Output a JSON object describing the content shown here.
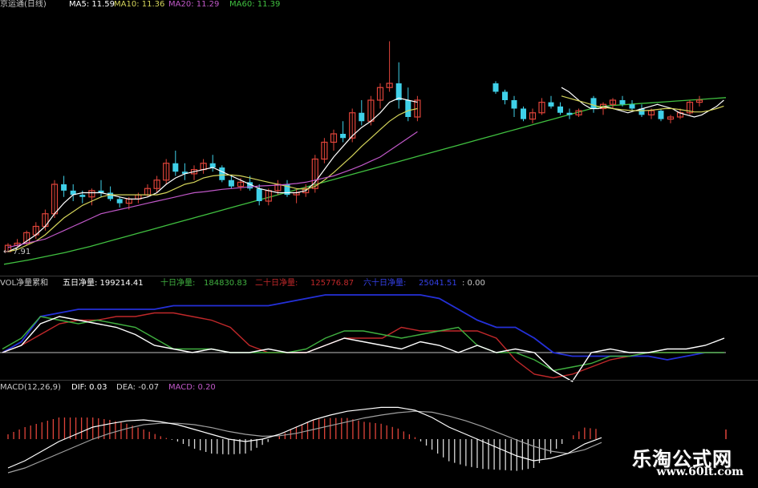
{
  "price_header": {
    "title": "京运通(日线)",
    "ma5": "MA5: 11.59",
    "ma10": "MA10: 11.36",
    "ma20": "MA20: 11.29",
    "ma60": "MA60: 11.39",
    "low_label": "7.91",
    "low_arrow": "←"
  },
  "vol_header": {
    "title": "VOL净量累和",
    "five_day": "五日净量: 199214.41",
    "ten_day_label": "十日净量:",
    "ten_day_value": "184830.83",
    "twenty_day_label": "二十日净量:",
    "twenty_day_value": "125776.87",
    "sixty_day_label": "六十日净量:",
    "sixty_day_value": "25041.51",
    "tail": ": 0.00"
  },
  "macd_header": {
    "title": "MACD(12,26,9)",
    "dif": "DIF: 0.03",
    "dea": "DEA: -0.07",
    "macd": "MACD: 0.20"
  },
  "watermark": {
    "line1": "乐淘公式网",
    "line2": "www.60lt.com"
  },
  "colors": {
    "up": "#e0443a",
    "down": "#3fd0e8",
    "ma5": "#ffffff",
    "ma10": "#d4d45a",
    "ma20": "#c058c8",
    "ma60": "#40c040",
    "vol_white": "#ffffff",
    "vol_green": "#40b040",
    "vol_red": "#c0282a",
    "vol_blue": "#2430d8",
    "zero_line": "#c0c0c0"
  },
  "chart_data": [
    {
      "type": "candlestick",
      "title": "京运通(日线)",
      "ylim": [
        7.5,
        13.5
      ],
      "candles": [
        [
          7.9,
          8.1,
          7.9,
          8.05
        ],
        [
          8.05,
          8.2,
          8.0,
          8.1
        ],
        [
          8.1,
          8.4,
          8.05,
          8.35
        ],
        [
          8.3,
          8.6,
          8.2,
          8.5
        ],
        [
          8.5,
          8.9,
          8.4,
          8.8
        ],
        [
          8.8,
          9.6,
          8.7,
          9.5
        ],
        [
          9.5,
          9.7,
          9.2,
          9.35
        ],
        [
          9.35,
          9.5,
          9.1,
          9.25
        ],
        [
          9.25,
          9.35,
          9.05,
          9.2
        ],
        [
          9.2,
          9.4,
          9.0,
          9.35
        ],
        [
          9.35,
          9.6,
          9.2,
          9.3
        ],
        [
          9.3,
          9.45,
          9.1,
          9.15
        ],
        [
          9.15,
          9.2,
          8.95,
          9.05
        ],
        [
          9.05,
          9.2,
          8.9,
          9.15
        ],
        [
          9.15,
          9.3,
          9.05,
          9.25
        ],
        [
          9.25,
          9.5,
          9.2,
          9.4
        ],
        [
          9.4,
          9.7,
          9.3,
          9.6
        ],
        [
          9.6,
          10.1,
          9.5,
          10.0
        ],
        [
          10.0,
          10.3,
          9.7,
          9.8
        ],
        [
          9.8,
          10.0,
          9.6,
          9.75
        ],
        [
          9.75,
          9.95,
          9.6,
          9.85
        ],
        [
          9.85,
          10.1,
          9.75,
          10.0
        ],
        [
          10.0,
          10.2,
          9.8,
          9.9
        ],
        [
          9.9,
          9.95,
          9.55,
          9.6
        ],
        [
          9.6,
          9.7,
          9.4,
          9.45
        ],
        [
          9.45,
          9.65,
          9.35,
          9.55
        ],
        [
          9.55,
          9.7,
          9.35,
          9.4
        ],
        [
          9.4,
          9.5,
          9.0,
          9.1
        ],
        [
          9.1,
          9.4,
          9.0,
          9.35
        ],
        [
          9.35,
          9.6,
          9.25,
          9.5
        ],
        [
          9.5,
          9.6,
          9.2,
          9.25
        ],
        [
          9.25,
          9.4,
          9.05,
          9.3
        ],
        [
          9.3,
          9.5,
          9.2,
          9.4
        ],
        [
          9.4,
          10.2,
          9.3,
          10.1
        ],
        [
          10.1,
          10.6,
          10.0,
          10.5
        ],
        [
          10.5,
          10.8,
          10.3,
          10.7
        ],
        [
          10.7,
          11.0,
          10.5,
          10.6
        ],
        [
          10.6,
          11.3,
          10.5,
          11.2
        ],
        [
          11.2,
          11.5,
          10.9,
          11.0
        ],
        [
          11.0,
          11.6,
          10.9,
          11.5
        ],
        [
          11.5,
          11.9,
          11.3,
          11.8
        ],
        [
          11.8,
          12.9,
          11.7,
          11.9
        ],
        [
          11.9,
          12.4,
          11.3,
          11.5
        ],
        [
          11.5,
          11.8,
          11.0,
          11.1
        ],
        [
          11.1,
          11.6,
          11.0,
          11.5
        ]
      ],
      "candles_b": [
        [
          11.9,
          11.95,
          11.65,
          11.7
        ],
        [
          11.7,
          11.75,
          11.4,
          11.5
        ],
        [
          11.5,
          11.6,
          11.1,
          11.3
        ],
        [
          11.3,
          11.35,
          11.0,
          11.05
        ],
        [
          11.05,
          11.3,
          10.95,
          11.2
        ],
        [
          11.2,
          11.55,
          11.15,
          11.45
        ],
        [
          11.45,
          11.6,
          11.3,
          11.35
        ],
        [
          11.35,
          11.45,
          11.15,
          11.2
        ],
        [
          11.2,
          11.3,
          11.05,
          11.15
        ],
        [
          11.15,
          11.3,
          11.1,
          11.25
        ]
      ],
      "candles_c": [
        [
          11.55,
          11.6,
          11.2,
          11.3
        ],
        [
          11.3,
          11.45,
          11.15,
          11.4
        ],
        [
          11.4,
          11.55,
          11.3,
          11.5
        ],
        [
          11.5,
          11.6,
          11.35,
          11.4
        ],
        [
          11.4,
          11.5,
          11.25,
          11.3
        ],
        [
          11.3,
          11.4,
          11.1,
          11.15
        ],
        [
          11.15,
          11.3,
          11.05,
          11.25
        ],
        [
          11.25,
          11.3,
          11.0,
          11.05
        ],
        [
          11.05,
          11.15,
          10.95,
          11.1
        ],
        [
          11.1,
          11.3,
          11.05,
          11.2
        ],
        [
          11.2,
          11.5,
          11.15,
          11.45
        ],
        [
          11.45,
          11.6,
          11.35,
          11.5
        ]
      ],
      "ma_series": [
        {
          "name": "MA5",
          "values": [
            7.9,
            8.0,
            8.15,
            8.3,
            8.5,
            8.8,
            9.05,
            9.25,
            9.3,
            9.3,
            9.3,
            9.25,
            9.2,
            9.15,
            9.15,
            9.2,
            9.3,
            9.5,
            9.65,
            9.75,
            9.8,
            9.85,
            9.9,
            9.8,
            9.7,
            9.6,
            9.5,
            9.4,
            9.35,
            9.3,
            9.3,
            9.3,
            9.35,
            9.55,
            9.85,
            10.15,
            10.4,
            10.65,
            10.85,
            11.0,
            11.2,
            11.45,
            11.55,
            11.5,
            11.45
          ]
        },
        {
          "name": "MA10",
          "values": [
            7.9,
            7.95,
            8.05,
            8.15,
            8.3,
            8.5,
            8.7,
            8.85,
            9.0,
            9.1,
            9.2,
            9.25,
            9.25,
            9.25,
            9.25,
            9.25,
            9.25,
            9.3,
            9.4,
            9.5,
            9.55,
            9.65,
            9.7,
            9.72,
            9.72,
            9.7,
            9.65,
            9.6,
            9.55,
            9.5,
            9.45,
            9.4,
            9.38,
            9.45,
            9.6,
            9.78,
            9.98,
            10.18,
            10.4,
            10.6,
            10.8,
            11.0,
            11.15,
            11.25,
            11.3
          ]
        },
        {
          "name": "MA20",
          "values": [
            8.0,
            8.05,
            8.1,
            8.15,
            8.2,
            8.3,
            8.4,
            8.5,
            8.6,
            8.7,
            8.8,
            8.85,
            8.9,
            8.95,
            9.0,
            9.05,
            9.1,
            9.15,
            9.2,
            9.25,
            9.3,
            9.32,
            9.35,
            9.38,
            9.4,
            9.42,
            9.44,
            9.46,
            9.47,
            9.48,
            9.5,
            9.52,
            9.55,
            9.6,
            9.65,
            9.7,
            9.78,
            9.86,
            9.95,
            10.05,
            10.15,
            10.3,
            10.45,
            10.6,
            10.75
          ]
        }
      ],
      "ma60_values": [
        7.6,
        7.65,
        7.7,
        7.76,
        7.82,
        7.88,
        7.95,
        8.02,
        8.1,
        8.18,
        8.26,
        8.34,
        8.42,
        8.5,
        8.58,
        8.66,
        8.74,
        8.82,
        8.9,
        8.98,
        9.06,
        9.14,
        9.22,
        9.3,
        9.38,
        9.46,
        9.54,
        9.62,
        9.7,
        9.78,
        9.86,
        9.94,
        10.02,
        10.1,
        10.18,
        10.26,
        10.34,
        10.42,
        10.5,
        10.58,
        10.66,
        10.74,
        10.82,
        10.9,
        10.98,
        11.06,
        11.14,
        11.22,
        11.3,
        11.36,
        11.38,
        11.4,
        11.42,
        11.44,
        11.46,
        11.48,
        11.5,
        11.52,
        11.54,
        11.56
      ]
    },
    {
      "type": "line",
      "title": "VOL净量累和",
      "series": [
        {
          "name": "五日净量",
          "values": [
            0.0,
            0.1,
            0.4,
            0.5,
            0.45,
            0.4,
            0.35,
            0.25,
            0.1,
            0.05,
            0.0,
            0.05,
            0.0,
            0.0,
            0.05,
            0.0,
            0.0,
            0.1,
            0.2,
            0.15,
            0.1,
            0.05,
            0.15,
            0.1,
            0.0,
            0.1,
            0.0,
            0.05,
            0.0,
            -0.25,
            -0.4,
            0.0,
            0.05,
            0.0,
            0.0,
            0.05,
            0.05,
            0.1,
            0.2
          ]
        },
        {
          "name": "十日净量",
          "values": [
            0.05,
            0.2,
            0.5,
            0.45,
            0.4,
            0.45,
            0.4,
            0.35,
            0.2,
            0.05,
            0.05,
            0.05,
            0.0,
            0.0,
            0.0,
            0.0,
            0.05,
            0.2,
            0.3,
            0.3,
            0.25,
            0.2,
            0.25,
            0.3,
            0.35,
            0.1,
            0.0,
            0.0,
            -0.1,
            -0.25,
            -0.2,
            -0.15,
            -0.05,
            -0.05,
            0.0,
            0.0,
            0.0,
            0.0,
            0.0
          ]
        },
        {
          "name": "二十日净量",
          "values": [
            0.0,
            0.1,
            0.25,
            0.4,
            0.45,
            0.45,
            0.5,
            0.5,
            0.55,
            0.55,
            0.5,
            0.45,
            0.35,
            0.1,
            0.0,
            0.0,
            0.0,
            0.1,
            0.2,
            0.2,
            0.2,
            0.35,
            0.3,
            0.3,
            0.3,
            0.3,
            0.2,
            -0.1,
            -0.3,
            -0.35,
            -0.3,
            -0.2,
            -0.1,
            -0.05,
            0.0,
            0.0,
            0.0,
            0.0,
            0.0
          ]
        },
        {
          "name": "六十日净量",
          "values": [
            0.0,
            0.15,
            0.5,
            0.55,
            0.6,
            0.6,
            0.6,
            0.6,
            0.6,
            0.65,
            0.65,
            0.65,
            0.65,
            0.65,
            0.65,
            0.7,
            0.75,
            0.8,
            0.8,
            0.8,
            0.8,
            0.8,
            0.8,
            0.75,
            0.6,
            0.45,
            0.35,
            0.35,
            0.2,
            0.0,
            -0.05,
            -0.05,
            -0.05,
            -0.05,
            -0.05,
            -0.1,
            -0.05,
            0.0,
            0.0
          ]
        }
      ]
    },
    {
      "type": "line",
      "title": "MACD(12,26,9)",
      "dif": [
        -0.6,
        -0.45,
        -0.25,
        -0.05,
        0.1,
        0.25,
        0.32,
        0.38,
        0.4,
        0.36,
        0.3,
        0.2,
        0.1,
        0.0,
        -0.05,
        0.0,
        0.1,
        0.25,
        0.4,
        0.5,
        0.58,
        0.62,
        0.66,
        0.66,
        0.6,
        0.45,
        0.25,
        0.1,
        -0.05,
        -0.2,
        -0.35,
        -0.45,
        -0.4,
        -0.3,
        -0.1,
        0.03
      ],
      "dea": [
        -0.7,
        -0.6,
        -0.45,
        -0.3,
        -0.15,
        0.0,
        0.12,
        0.22,
        0.3,
        0.33,
        0.33,
        0.3,
        0.24,
        0.16,
        0.1,
        0.06,
        0.07,
        0.12,
        0.2,
        0.28,
        0.36,
        0.44,
        0.5,
        0.55,
        0.58,
        0.56,
        0.48,
        0.38,
        0.26,
        0.12,
        -0.02,
        -0.15,
        -0.25,
        -0.3,
        -0.22,
        -0.07
      ],
      "macd": [
        0.1,
        0.25,
        0.35,
        0.45,
        0.45,
        0.45,
        0.4,
        0.32,
        0.2,
        0.06,
        -0.05,
        -0.2,
        -0.3,
        -0.32,
        -0.3,
        -0.12,
        0.06,
        0.26,
        0.4,
        0.44,
        0.44,
        0.36,
        0.32,
        0.22,
        0.04,
        -0.22,
        -0.46,
        -0.56,
        -0.62,
        -0.64,
        -0.66,
        -0.6,
        -0.3,
        0.0,
        0.24,
        0.2
      ]
    }
  ]
}
